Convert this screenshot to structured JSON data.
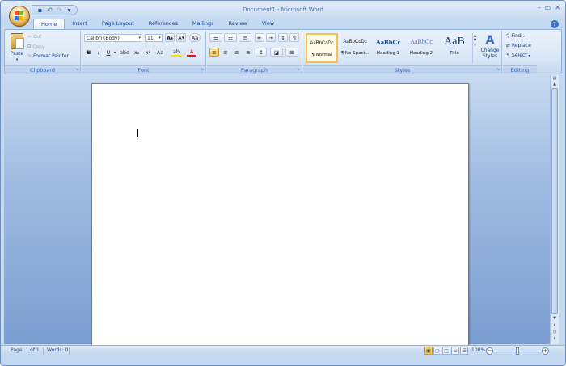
{
  "window": {
    "title": "Document1 - Microsoft Word",
    "controls": [
      "–",
      "▭",
      "✕"
    ]
  },
  "qat": {
    "icons": [
      "save-icon",
      "undo-icon",
      "redo-icon",
      "customize-icon"
    ]
  },
  "tabs": [
    "Home",
    "Insert",
    "Page Layout",
    "References",
    "Mailings",
    "Review",
    "View"
  ],
  "active_tab": "Home",
  "help": "?",
  "clipboard": {
    "label": "Clipboard",
    "paste": "Paste",
    "cut": "Cut",
    "copy": "Copy",
    "format_painter": "Format Painter"
  },
  "font": {
    "label": "Font",
    "font_name": "Calibri (Body)",
    "font_size": "11",
    "grow": "A",
    "shrink": "A",
    "clear": "Aa",
    "bold": "B",
    "italic": "I",
    "underline": "U",
    "strike": "abe",
    "subscript": "x₂",
    "superscript": "x²",
    "change_case": "Aa",
    "highlight": "ab",
    "font_color": "A"
  },
  "paragraph": {
    "label": "Paragraph",
    "pilcrow": "¶"
  },
  "styles": {
    "label": "Styles",
    "items": [
      {
        "sample": "AaBbCcDc",
        "name": "¶ Normal"
      },
      {
        "sample": "AaBbCcDc",
        "name": "¶ No Spaci..."
      },
      {
        "sample": "AaBbCc",
        "name": "Heading 1"
      },
      {
        "sample": "AaBbCc",
        "name": "Heading 2"
      },
      {
        "sample": "AaB",
        "name": "Title"
      }
    ],
    "change_styles": "Change Styles"
  },
  "editing": {
    "label": "Editing",
    "find": "Find",
    "replace": "Replace",
    "select": "Select"
  },
  "status": {
    "page": "Page: 1 of 1",
    "words": "Words: 0",
    "zoom": "100%",
    "zoom_value": 100
  },
  "colors": {
    "accent": "#15428b",
    "ribbon": "#dbe8f7",
    "doc_bg": "#9fbbe1"
  }
}
